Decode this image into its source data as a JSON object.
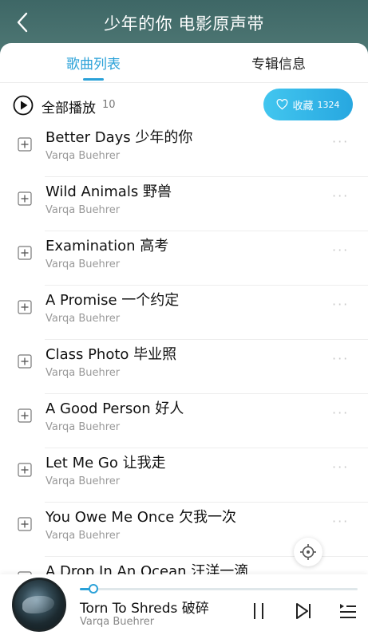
{
  "header": {
    "title": "少年的你 电影原声带"
  },
  "tabs": [
    {
      "label": "歌曲列表",
      "active": true
    },
    {
      "label": "专辑信息",
      "active": false
    }
  ],
  "play_all": {
    "label": "全部播放",
    "count": "10"
  },
  "collect": {
    "label": "收藏",
    "count": "1324"
  },
  "songs": [
    {
      "title": "Better Days 少年的你",
      "artist": "Varqa Buehrer"
    },
    {
      "title": "Wild Animals 野兽",
      "artist": "Varqa Buehrer"
    },
    {
      "title": "Examination 高考",
      "artist": "Varqa Buehrer"
    },
    {
      "title": "A Promise 一个约定",
      "artist": "Varqa Buehrer"
    },
    {
      "title": "Class Photo 毕业照",
      "artist": "Varqa Buehrer"
    },
    {
      "title": "A Good Person 好人",
      "artist": "Varqa Buehrer"
    },
    {
      "title": "Let Me Go 让我走",
      "artist": "Varqa Buehrer"
    },
    {
      "title": "You Owe Me Once 欠我一次",
      "artist": "Varqa Buehrer"
    },
    {
      "title": "A Drop In An Ocean 汪洋一滴",
      "artist": ""
    }
  ],
  "more_glyph": "···",
  "now_playing": {
    "title": "Torn To Shreds 破碎",
    "artist": "Varqa Buehrer",
    "progress": 0.05
  },
  "icons": {
    "back": "chevron-left-icon",
    "play_all": "play-circle-icon",
    "collect": "heart-outline-icon",
    "add": "add-box-icon",
    "more": "more-horizontal-icon",
    "locate": "crosshair-icon",
    "pause": "pause-icon",
    "next": "skip-next-icon",
    "playlist": "playlist-icon"
  },
  "colors": {
    "accent": "#2aa1d8",
    "header_bg": "#3f6a69"
  }
}
